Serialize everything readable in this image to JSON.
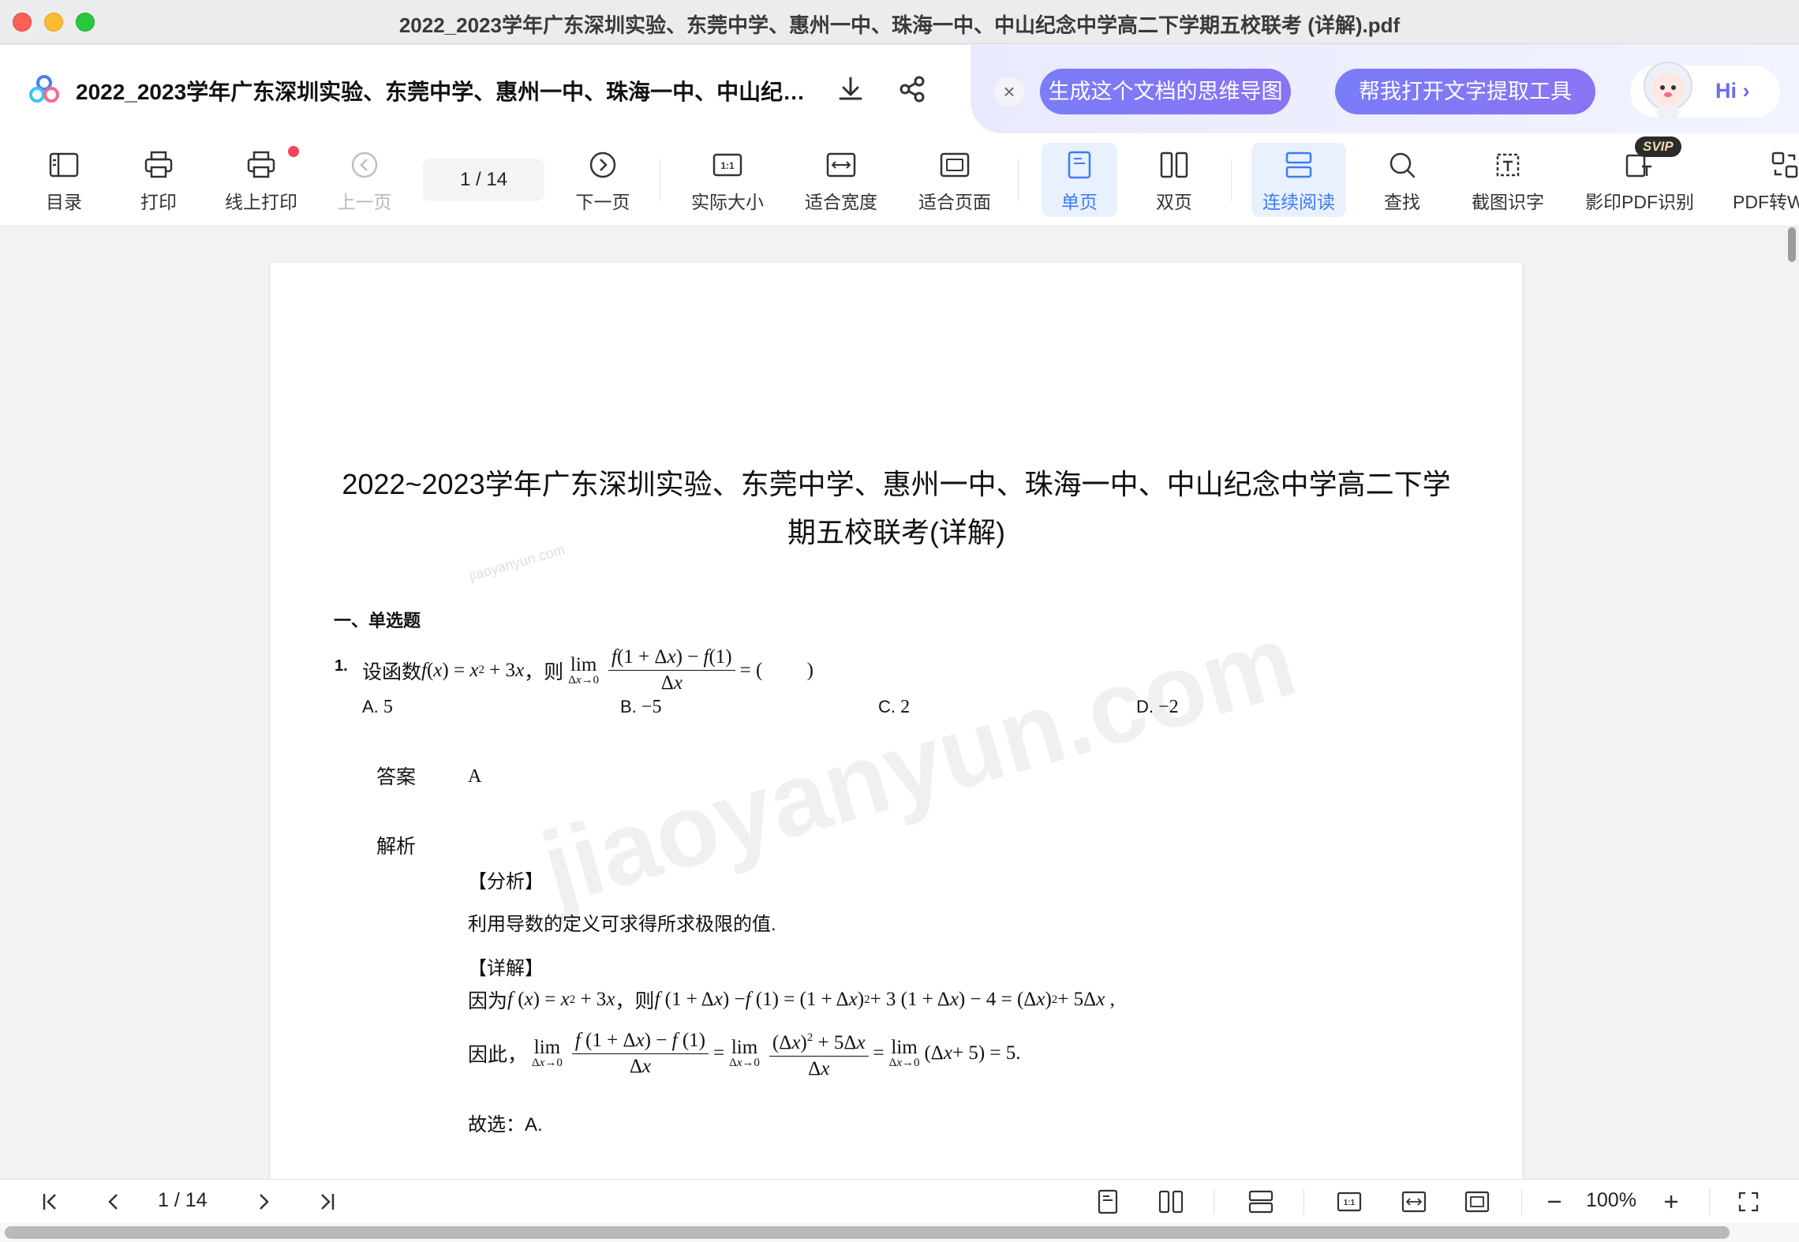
{
  "window": {
    "title": "2022_2023学年广东深圳实验、东莞中学、惠州一中、珠海一中、中山纪念中学高二下学期五校联考 (详解).pdf"
  },
  "docbar": {
    "doc_name": "2022_2023学年广东深圳实验、东莞中学、惠州一中、珠海一中、中山纪念中学高二下学期五校联考 (详解).pdf",
    "ai_mindmap": "生成这个文档的思维导图",
    "ai_ocr": "帮我打开文字提取工具",
    "ai_hi": "Hi"
  },
  "toolbar": {
    "toc": "目录",
    "print": "打印",
    "online_print": "线上打印",
    "prev": "上一页",
    "page_indicator": "1  / 14",
    "next": "下一页",
    "actual_size": "实际大小",
    "fit_width": "适合宽度",
    "fit_page": "适合页面",
    "single": "单页",
    "double": "双页",
    "continuous": "连续阅读",
    "find": "查找",
    "screenshot_ocr": "截图识字",
    "scan_ocr": "影印PDF识别",
    "svip": "SVIP",
    "pdf_convert": "PDF转W"
  },
  "page": {
    "title_line1": "2022~2023学年广东深圳实验、东莞中学、惠州一中、珠海一中、中山纪念中学高二下学",
    "title_line2": "期五校联考(详解)",
    "section": "一、单选题",
    "q1_number": "1.",
    "q1_prefix": "设函数",
    "q1_then": "，则",
    "options": {
      "a_label": "A.",
      "a_val": "5",
      "b_label": "B.",
      "b_val": "−5",
      "c_label": "C.",
      "c_val": "2",
      "d_label": "D.",
      "d_val": "−2"
    },
    "answer_tag": "答案",
    "answer": "A",
    "analysis_tag": "解析",
    "analysis_head": "【分析】",
    "analysis_text": "利用导数的定义可求得所求极限的值.",
    "detail_head": "【详解】",
    "detail_because": "因为",
    "detail_then": "，则",
    "detail_therefore": "因此，",
    "detail_choose": "故选：A.",
    "watermark": "jiaoyanyun.com"
  },
  "statusbar": {
    "page_indicator": "1  / 14",
    "zoom": "100%"
  }
}
